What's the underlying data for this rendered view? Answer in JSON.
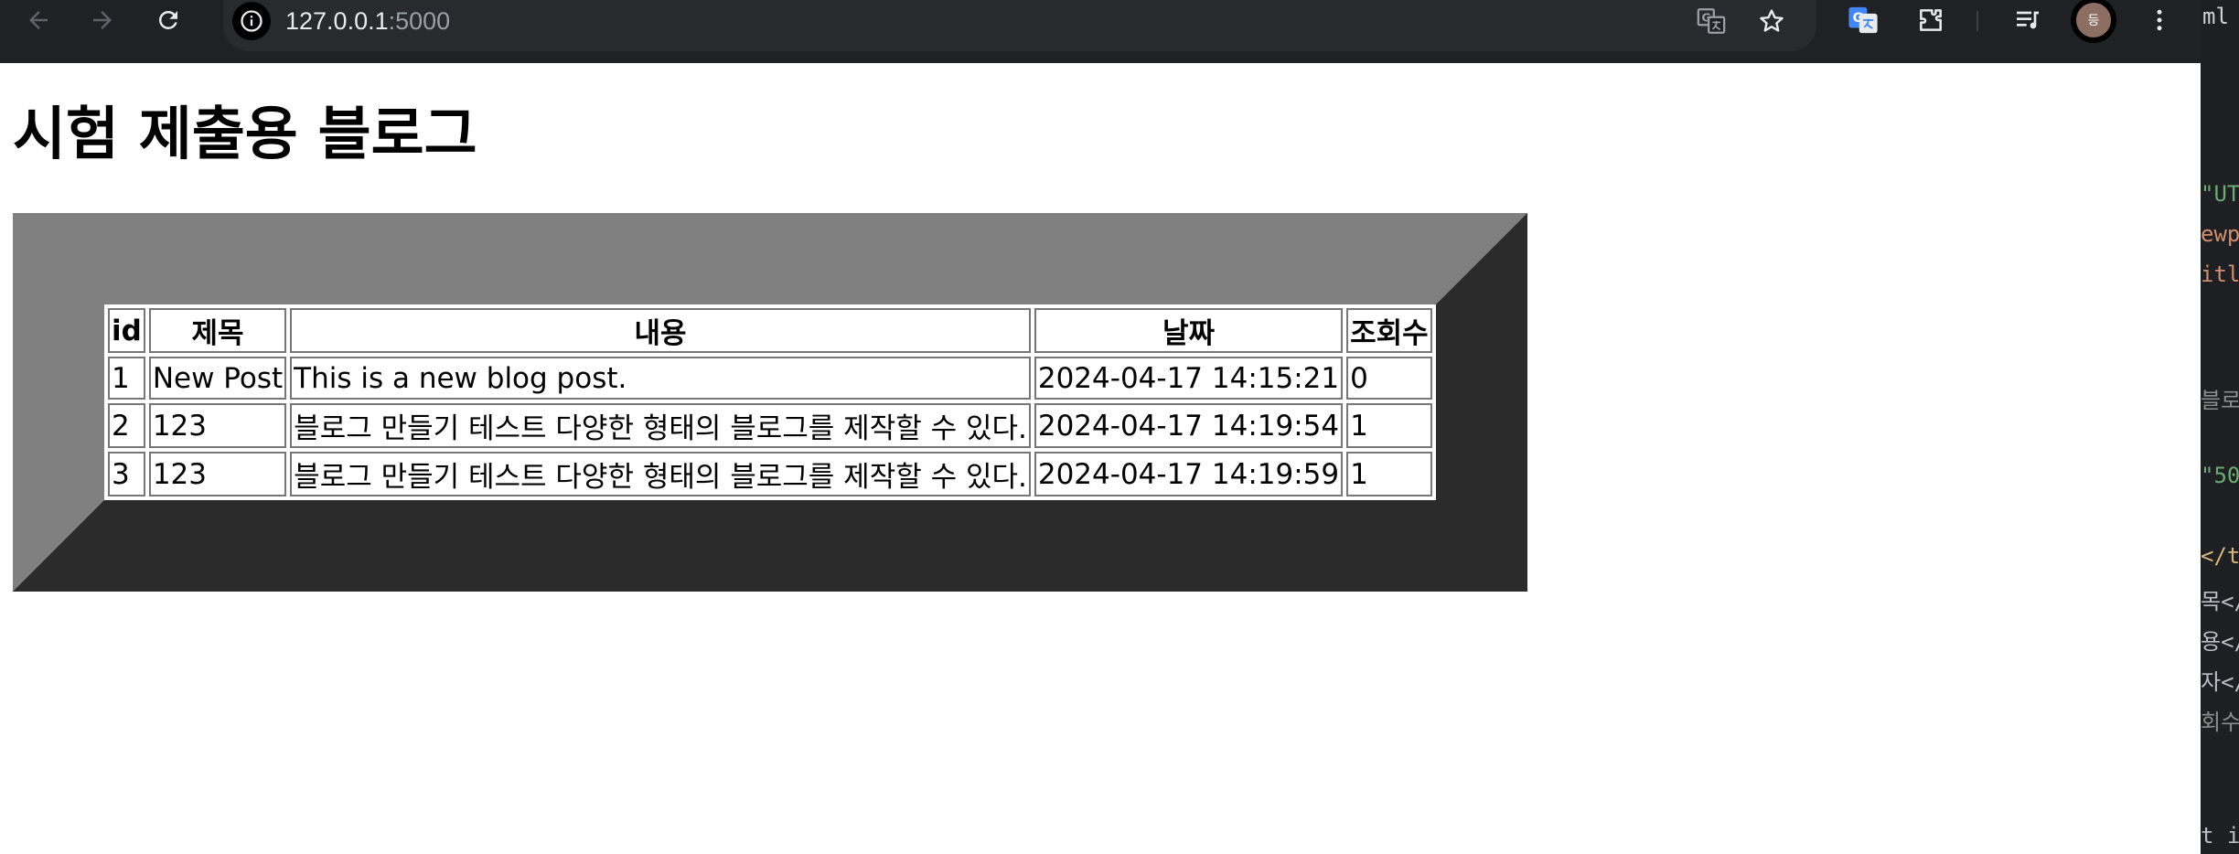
{
  "browser": {
    "url_host": "127.0.0.1",
    "url_port": ":5000",
    "profile_initial": "등"
  },
  "page": {
    "title": "시험 제출용 블로그"
  },
  "table": {
    "headers": [
      "id",
      "제목",
      "내용",
      "날짜",
      "조회수"
    ],
    "rows": [
      [
        "1",
        "New Post",
        "This is a new blog post.",
        "2024-04-17 14:15:21",
        "0"
      ],
      [
        "2",
        "123",
        "블로그 만들기 테스트 다양한 형태의 블로그를 제작할 수 있다.",
        "2024-04-17 14:19:54",
        "1"
      ],
      [
        "3",
        "123",
        "블로그 만들기 테스트 다양한 형태의 블로그를 제작할 수 있다.",
        "2024-04-17 14:19:59",
        "1"
      ]
    ]
  },
  "editor": {
    "tab_text": "ml",
    "lines": [
      "\"UT",
      "ewp",
      "itl",
      "블로",
      "\"50",
      "</t",
      "목</",
      "용</",
      "자</",
      "회수",
      "t i"
    ]
  },
  "icons": {
    "back": "arrow-left-icon",
    "forward": "arrow-right-icon",
    "reload": "reload-icon",
    "site_info": "info-icon",
    "translate": "translate-icon",
    "bookmark": "star-icon",
    "extension_translate": "google-translate-icon",
    "extensions": "puzzle-icon",
    "media": "media-queue-icon",
    "menu": "kebab-menu-icon"
  },
  "colors": {
    "chrome_bg": "#202124",
    "omnibox_bg": "#282a2d",
    "table_border_light": "#808080",
    "table_border_dark": "#2b2b2b",
    "editor_bg": "#1e1f22"
  }
}
